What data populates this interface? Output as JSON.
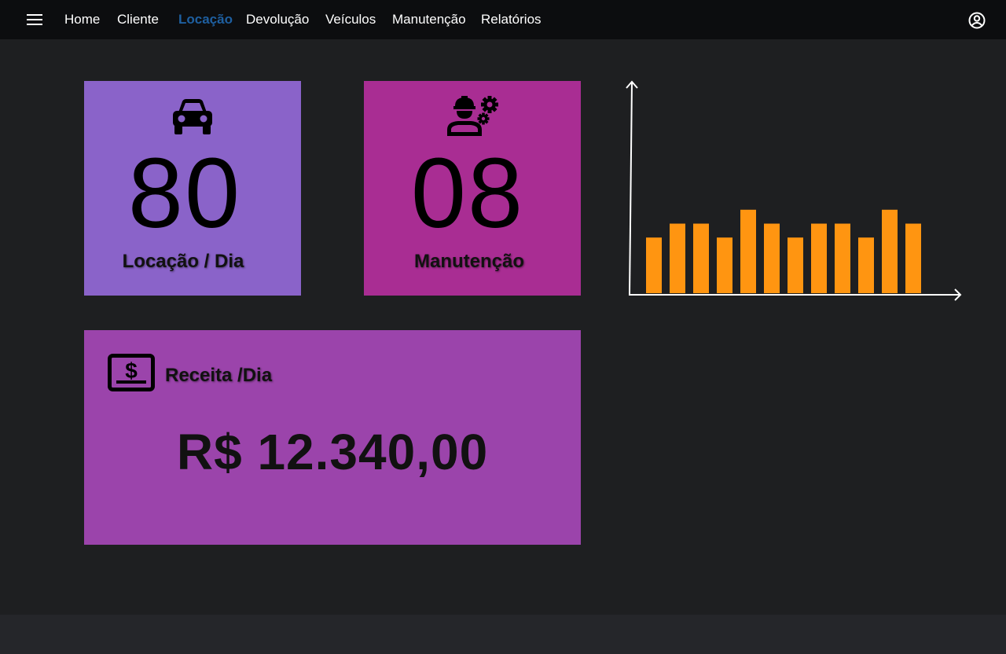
{
  "nav": {
    "items": [
      {
        "label": "Home",
        "active": false
      },
      {
        "label": "Cliente",
        "active": false
      },
      {
        "label": "Locação",
        "active": true
      },
      {
        "label": "Devolução",
        "active": false
      },
      {
        "label": "Veículos",
        "active": false
      },
      {
        "label": "Manutenção",
        "active": false
      },
      {
        "label": "Relatórios",
        "active": false
      }
    ],
    "menu_icon": "hamburger-menu-icon",
    "account_icon": "account-circle-icon"
  },
  "cards": {
    "rentals": {
      "value": "80",
      "label": "Locação / Dia",
      "icon": "car-icon",
      "color": "#8a63c9"
    },
    "maintenance": {
      "value": "08",
      "label": "Manutenção",
      "icon": "mechanic-gears-icon",
      "color": "#a92d93"
    },
    "revenue": {
      "title": "Receita /Dia",
      "value": "R$ 12.340,00",
      "icon": "dollar-bill-icon",
      "color": "#9b44ab"
    }
  },
  "chart_data": {
    "type": "bar",
    "values": [
      4,
      5,
      5,
      4,
      6,
      5,
      4,
      5,
      5,
      4,
      6,
      5
    ],
    "ylim": [
      0,
      10
    ],
    "bar_color": "#ff9511",
    "axis_color": "#ffffff",
    "grid": false
  },
  "colors": {
    "background": "#1e1f21",
    "topbar": "#0c0d0f",
    "footer": "#25262a",
    "nav_active": "#1e5fa0"
  }
}
